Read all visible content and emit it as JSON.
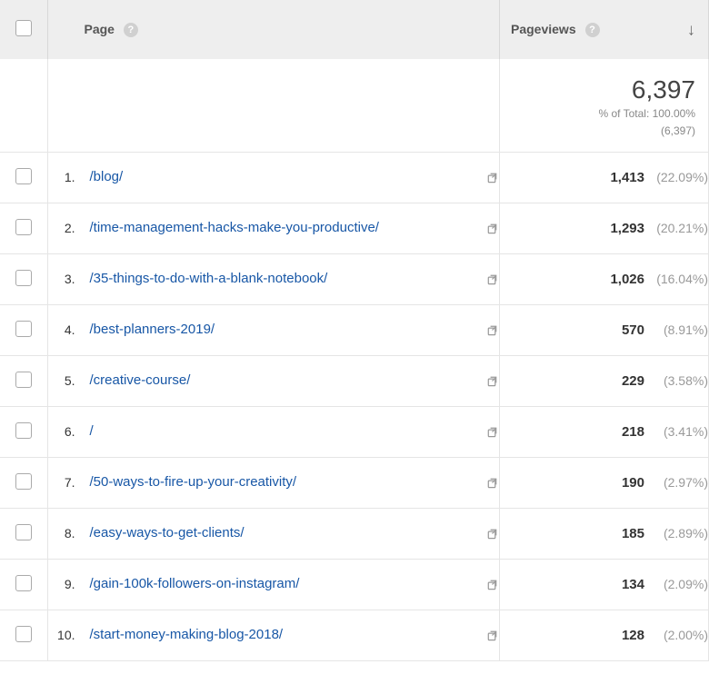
{
  "header": {
    "page_col": "Page",
    "pageviews_col": "Pageviews"
  },
  "summary": {
    "total": "6,397",
    "pct_label": "% of Total: 100.00%",
    "total_sub": "(6,397)"
  },
  "rows": [
    {
      "num": "1.",
      "page": "/blog/",
      "views": "1,413",
      "pct": "(22.09%)"
    },
    {
      "num": "2.",
      "page": "/time-management-hacks-make-you-productive/",
      "views": "1,293",
      "pct": "(20.21%)"
    },
    {
      "num": "3.",
      "page": "/35-things-to-do-with-a-blank-notebook/",
      "views": "1,026",
      "pct": "(16.04%)"
    },
    {
      "num": "4.",
      "page": "/best-planners-2019/",
      "views": "570",
      "pct": "(8.91%)"
    },
    {
      "num": "5.",
      "page": "/creative-course/",
      "views": "229",
      "pct": "(3.58%)"
    },
    {
      "num": "6.",
      "page": "/",
      "views": "218",
      "pct": "(3.41%)"
    },
    {
      "num": "7.",
      "page": "/50-ways-to-fire-up-your-creativity/",
      "views": "190",
      "pct": "(2.97%)"
    },
    {
      "num": "8.",
      "page": "/easy-ways-to-get-clients/",
      "views": "185",
      "pct": "(2.89%)"
    },
    {
      "num": "9.",
      "page": "/gain-100k-followers-on-instagram/",
      "views": "134",
      "pct": "(2.09%)"
    },
    {
      "num": "10.",
      "page": "/start-money-making-blog-2018/",
      "views": "128",
      "pct": "(2.00%)"
    }
  ]
}
